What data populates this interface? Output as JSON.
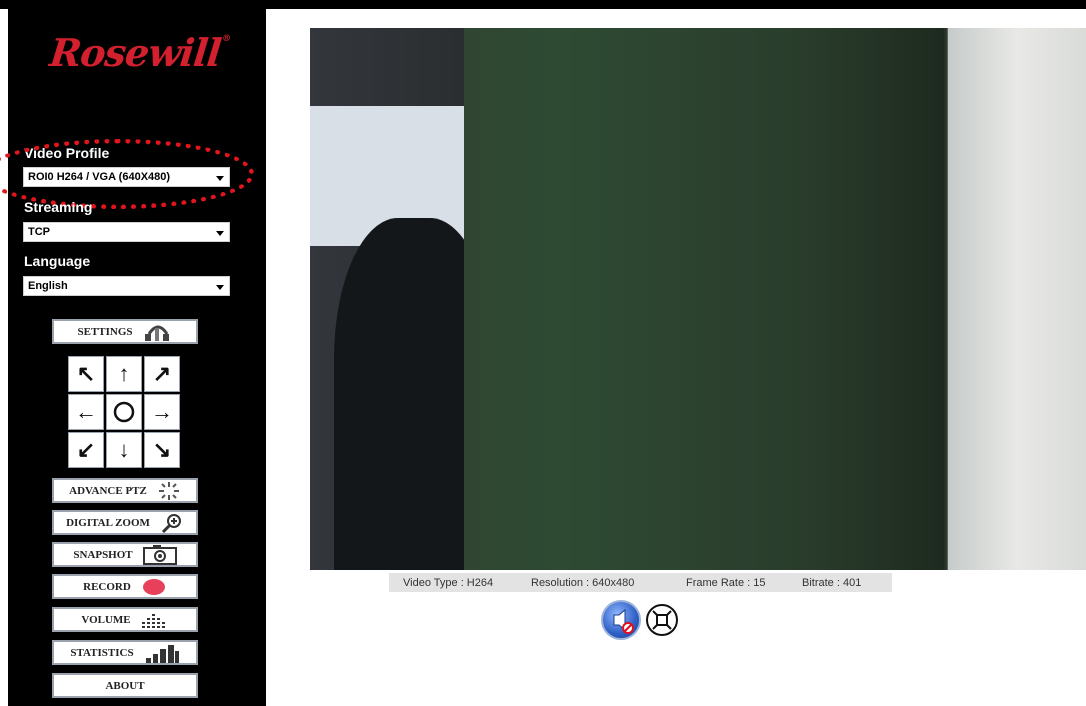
{
  "brand": {
    "name": "Rosewill",
    "trademark": "®"
  },
  "sidebar": {
    "video_profile": {
      "label": "Video Profile",
      "value": "ROI0 H264 / VGA (640X480)"
    },
    "streaming": {
      "label": "Streaming",
      "value": "TCP"
    },
    "language": {
      "label": "Language",
      "value": "English"
    },
    "buttons": {
      "settings": "SETTINGS",
      "advance_ptz": "ADVANCE PTZ",
      "digital_zoom": "DIGITAL ZOOM",
      "snapshot": "SNAPSHOT",
      "record": "RECORD",
      "volume": "VOLUME",
      "statistics": "STATISTICS",
      "about": "ABOUT"
    },
    "ptz_icons": [
      "arrow-up-left-icon",
      "arrow-up-icon",
      "arrow-up-right-icon",
      "arrow-left-icon",
      "home-circle-icon",
      "arrow-right-icon",
      "arrow-down-left-icon",
      "arrow-down-icon",
      "arrow-down-right-icon"
    ]
  },
  "stats": {
    "video_type": "Video Type : H264",
    "resolution": "Resolution : 640x480",
    "frame_rate": "Frame Rate : 15",
    "bitrate": "Bitrate : 401"
  },
  "colors": {
    "brand_red": "#d3202f",
    "highlight_red": "#e2141c",
    "record_red": "#e8405a",
    "sidebar_bg": "#000000"
  }
}
